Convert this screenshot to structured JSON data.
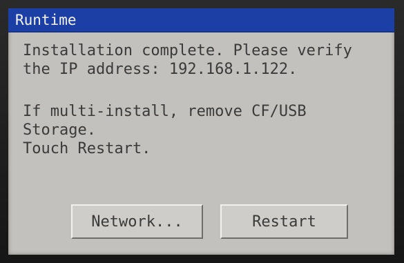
{
  "window": {
    "title": "Runtime"
  },
  "message": {
    "line1": "Installation complete. Please verify",
    "line2": "the IP address: 192.168.1.122.",
    "line3": "If multi-install, remove CF/USB",
    "line4": "Storage.",
    "line5": "Touch Restart."
  },
  "buttons": {
    "network_label": "Network...",
    "restart_label": "Restart"
  },
  "colors": {
    "titlebar": "#1c3fa6",
    "screen_background": "#c3c1bd",
    "text": "#3a3a3a"
  }
}
